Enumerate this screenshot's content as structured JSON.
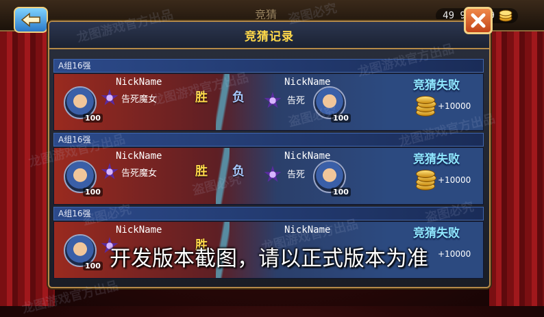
{
  "topbar": {
    "title": "竞猜",
    "coins": "49 9?? 99"
  },
  "dialog": {
    "title": "竞猜记录"
  },
  "records": [
    {
      "group": "A组16强",
      "left": {
        "nickname": "NickName",
        "faction": "告死魔女",
        "level": "100"
      },
      "win_label": "胜",
      "lose_label": "负",
      "right": {
        "nickname": "NickName",
        "faction": "告死",
        "level": "100"
      },
      "result": "竞猜失败",
      "reward": "+10000"
    },
    {
      "group": "A组16强",
      "left": {
        "nickname": "NickName",
        "faction": "告死魔女",
        "level": "100"
      },
      "win_label": "胜",
      "lose_label": "负",
      "right": {
        "nickname": "NickName",
        "faction": "告死",
        "level": "100"
      },
      "result": "竞猜失败",
      "reward": "+10000"
    },
    {
      "group": "A组16强",
      "left": {
        "nickname": "NickName",
        "faction": "",
        "level": "100"
      },
      "win_label": "胜",
      "lose_label": "",
      "right": {
        "nickname": "NickName",
        "faction": "",
        "level": ""
      },
      "result": "竞猜失败",
      "reward": "+10000"
    }
  ],
  "watermark_texts": [
    "龙图游戏官方出品",
    "盗图必究"
  ],
  "dev_notice": "开发版本截图，请以正式版本为准",
  "colors": {
    "accent_gold": "#ffd84a",
    "result_cyan": "#8fe7ff",
    "panel_border": "#b58a48"
  },
  "icons": [
    "back-arrow-icon",
    "close-x-icon",
    "coin-icon",
    "emblem-icon",
    "portrait-icon"
  ]
}
